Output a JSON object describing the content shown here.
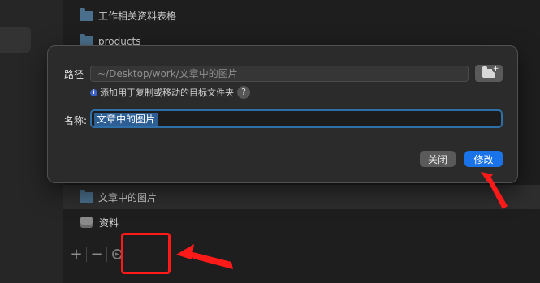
{
  "background": {
    "list_rows": [
      {
        "label": "工作相关资料表格",
        "icon": "folder-icon",
        "selected": false
      },
      {
        "label": "products",
        "icon": "folder-icon",
        "selected": false
      },
      {
        "label": "文章中的图片",
        "icon": "folder-icon",
        "selected": true
      },
      {
        "label": "资料",
        "icon": "drive-icon",
        "selected": false
      }
    ],
    "toolbar": {
      "add_label": "+",
      "remove_label": "−"
    }
  },
  "dialog": {
    "path_label": "路径",
    "path_value": "~/Desktop/work/文章中的图片",
    "hint_text": "添加用于复制或移动的目标文件夹",
    "help_label": "?",
    "info_icon_label": "i",
    "name_label": "名称:",
    "name_value": "文章中的图片",
    "close_button": "关闭",
    "modify_button": "修改"
  },
  "colors": {
    "accent": "#1a73e8",
    "annotation": "#ff1a1a"
  }
}
